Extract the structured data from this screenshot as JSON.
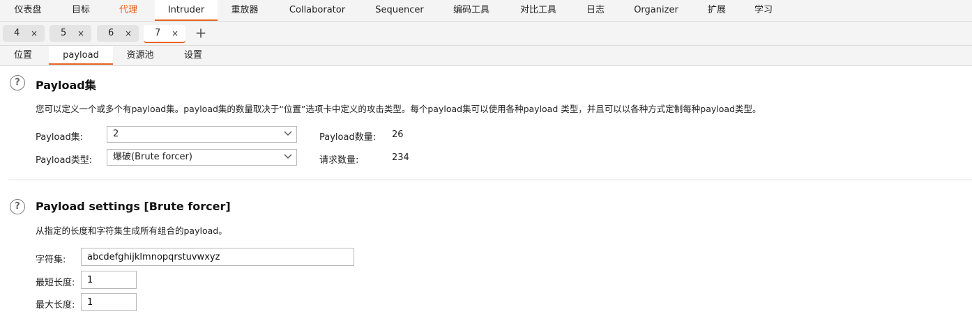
{
  "top_menu": {
    "items": [
      {
        "label": "仪表盘"
      },
      {
        "label": "目标"
      },
      {
        "label": "代理"
      },
      {
        "label": "Intruder"
      },
      {
        "label": "重放器"
      },
      {
        "label": "Collaborator"
      },
      {
        "label": "Sequencer"
      },
      {
        "label": "编码工具"
      },
      {
        "label": "对比工具"
      },
      {
        "label": "日志"
      },
      {
        "label": "Organizer"
      },
      {
        "label": "扩展"
      },
      {
        "label": "学习"
      }
    ],
    "active": "Intruder",
    "accent_color": "#e8611f"
  },
  "attack_tabs": {
    "items": [
      {
        "label": "4",
        "close": "×"
      },
      {
        "label": "5",
        "close": "×"
      },
      {
        "label": "6",
        "close": "×"
      },
      {
        "label": "7",
        "close": "×"
      }
    ],
    "active": "7",
    "add_label": "+"
  },
  "section_tabs": {
    "items": [
      {
        "label": "位置"
      },
      {
        "label": "payload"
      },
      {
        "label": "资源池"
      },
      {
        "label": "设置"
      }
    ],
    "active": "payload"
  },
  "payload_sets": {
    "help_icon": "?",
    "title": "Payload集",
    "description": "您可以定义一个或多个有payload集。payload集的数量取决于“位置”选项卡中定义的攻击类型。每个payload集可以使用各种payload 类型，并且可以以各种方式定制每种payload类型。",
    "set_label": "Payload集:",
    "set_value": "2",
    "type_label": "Payload类型:",
    "type_value": "爆破(Brute forcer)",
    "count_label": "Payload数量:",
    "count_value": "26",
    "request_label": "请求数量:",
    "request_value": "234"
  },
  "payload_settings": {
    "help_icon": "?",
    "title": "Payload settings [Brute forcer]",
    "description": "从指定的长度和字符集生成所有组合的payload。",
    "charset_label": "字符集:",
    "charset_value": "abcdefghijklmnopqrstuvwxyz",
    "min_label": "最短长度:",
    "min_value": "1",
    "max_label": "最大长度:",
    "max_value": "1"
  }
}
